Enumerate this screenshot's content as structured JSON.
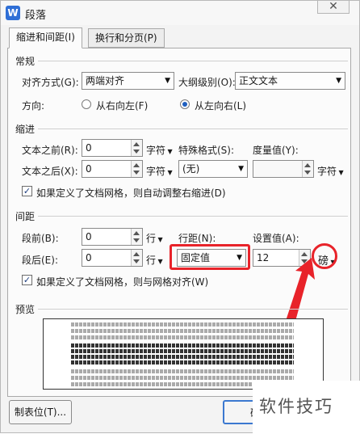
{
  "window": {
    "title": "段落",
    "app_icon_glyph": "W",
    "close_glyph": "✕"
  },
  "tabs": [
    {
      "label": "缩进和间距(I)",
      "active": true
    },
    {
      "label": "换行和分页(P)",
      "active": false
    }
  ],
  "general": {
    "section": "常规",
    "alignment_label": "对齐方式(G):",
    "alignment_value": "两端对齐",
    "outline_label": "大纲级别(O):",
    "outline_value": "正文文本",
    "direction_label": "方向:",
    "rtl_label": "从右向左(F)",
    "ltr_label": "从左向右(L)",
    "direction_selected": "ltr"
  },
  "indent": {
    "section": "缩进",
    "before_label": "文本之前(R):",
    "before_value": "0",
    "before_unit": "字符",
    "after_label": "文本之后(X):",
    "after_value": "0",
    "after_unit": "字符",
    "special_label": "特殊格式(S):",
    "special_value": "(无)",
    "measure_label": "度量值(Y):",
    "measure_value": "",
    "measure_unit": "字符",
    "grid_check_label": "如果定义了文档网格，则自动调整右缩进(D)",
    "grid_checked": true
  },
  "spacing": {
    "section": "间距",
    "before_label": "段前(B):",
    "before_value": "0",
    "before_unit": "行",
    "after_label": "段后(E):",
    "after_value": "0",
    "after_unit": "行",
    "line_label": "行距(N):",
    "line_value": "固定值",
    "setting_label": "设置值(A):",
    "setting_value": "12",
    "setting_unit": "磅",
    "grid_check_label": "如果定义了文档网格，则与网格对齐(W)",
    "grid_checked": true
  },
  "preview": {
    "section": "预览",
    "sample_line": "前一段落前一段落前一段落前一段落前一段落前一段落前一段落前一段落前一段落"
  },
  "buttons": {
    "tabs_label": "制表位(T)...",
    "ok_label": "确"
  },
  "watermark": {
    "text": "软件技巧"
  },
  "colors": {
    "highlight": "#e8232a",
    "accent": "#1f5fbf"
  }
}
